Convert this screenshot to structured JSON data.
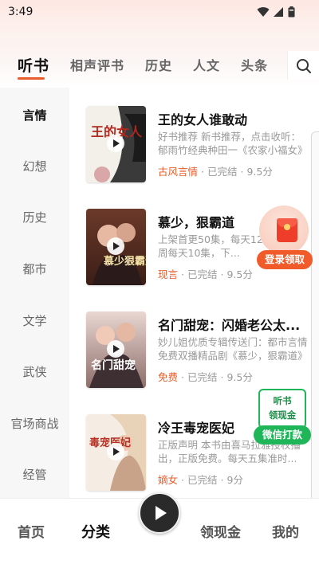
{
  "status_bar": {
    "time": "3:49"
  },
  "top_tabs": [
    {
      "label": "听书",
      "active": true
    },
    {
      "label": "相声评书",
      "active": false
    },
    {
      "label": "历史",
      "active": false
    },
    {
      "label": "人文",
      "active": false
    },
    {
      "label": "头条",
      "active": false
    }
  ],
  "search": {
    "icon": "search-icon"
  },
  "sidebar": {
    "items": [
      {
        "label": "言情",
        "active": true
      },
      {
        "label": "幻想",
        "active": false
      },
      {
        "label": "历史",
        "active": false
      },
      {
        "label": "都市",
        "active": false
      },
      {
        "label": "文学",
        "active": false
      },
      {
        "label": "武侠",
        "active": false
      },
      {
        "label": "官场商战",
        "active": false
      },
      {
        "label": "经管",
        "active": false
      }
    ]
  },
  "books": [
    {
      "title": "王的女人谁敢动",
      "desc": "好书推荐 新书推荐，点击收听：郁雨竹经典种田一《农家小福女》",
      "tag": "古风言情",
      "status": "已完结",
      "score": "9.5分",
      "cover_text": "王的女人"
    },
    {
      "title": "慕少，狠霸道",
      "desc": "上架首更50集，每天12集，第一周每天10集，下...",
      "tag": "现言",
      "status": "已完结",
      "score": "9.5分",
      "cover_text": "慕少狠霸道"
    },
    {
      "title": "名门甜宠：闪婚老公太...",
      "desc": "妙儿姐优质专辑传送门：都市言情免费双播精品剧《慕少，狠霸道》",
      "tag": "免费",
      "status": "已完结",
      "score": "9.5分",
      "cover_text": "名门甜宠"
    },
    {
      "title": "冷王毒宠医妃",
      "desc": "正版声明 本书由喜马拉雅授权播出，正版免费。每天五集准时...",
      "tag": "嫡女",
      "status": "已完结",
      "score": "9分",
      "cover_text": "毒宠医妃"
    }
  ],
  "meta_separator": "·",
  "floats": {
    "login": {
      "label": "登录领取"
    },
    "wechat": {
      "line1": "听书",
      "line2": "领现金",
      "button": "微信打款"
    }
  },
  "bottom_nav": [
    {
      "label": "首页",
      "active": false
    },
    {
      "label": "分类",
      "active": true
    },
    {
      "label": "领现金",
      "active": false
    },
    {
      "label": "我的",
      "active": false
    }
  ],
  "colors": {
    "accent": "#e85c2b",
    "wechat_green": "#1fb65a",
    "login_red": "#f15b2a"
  }
}
